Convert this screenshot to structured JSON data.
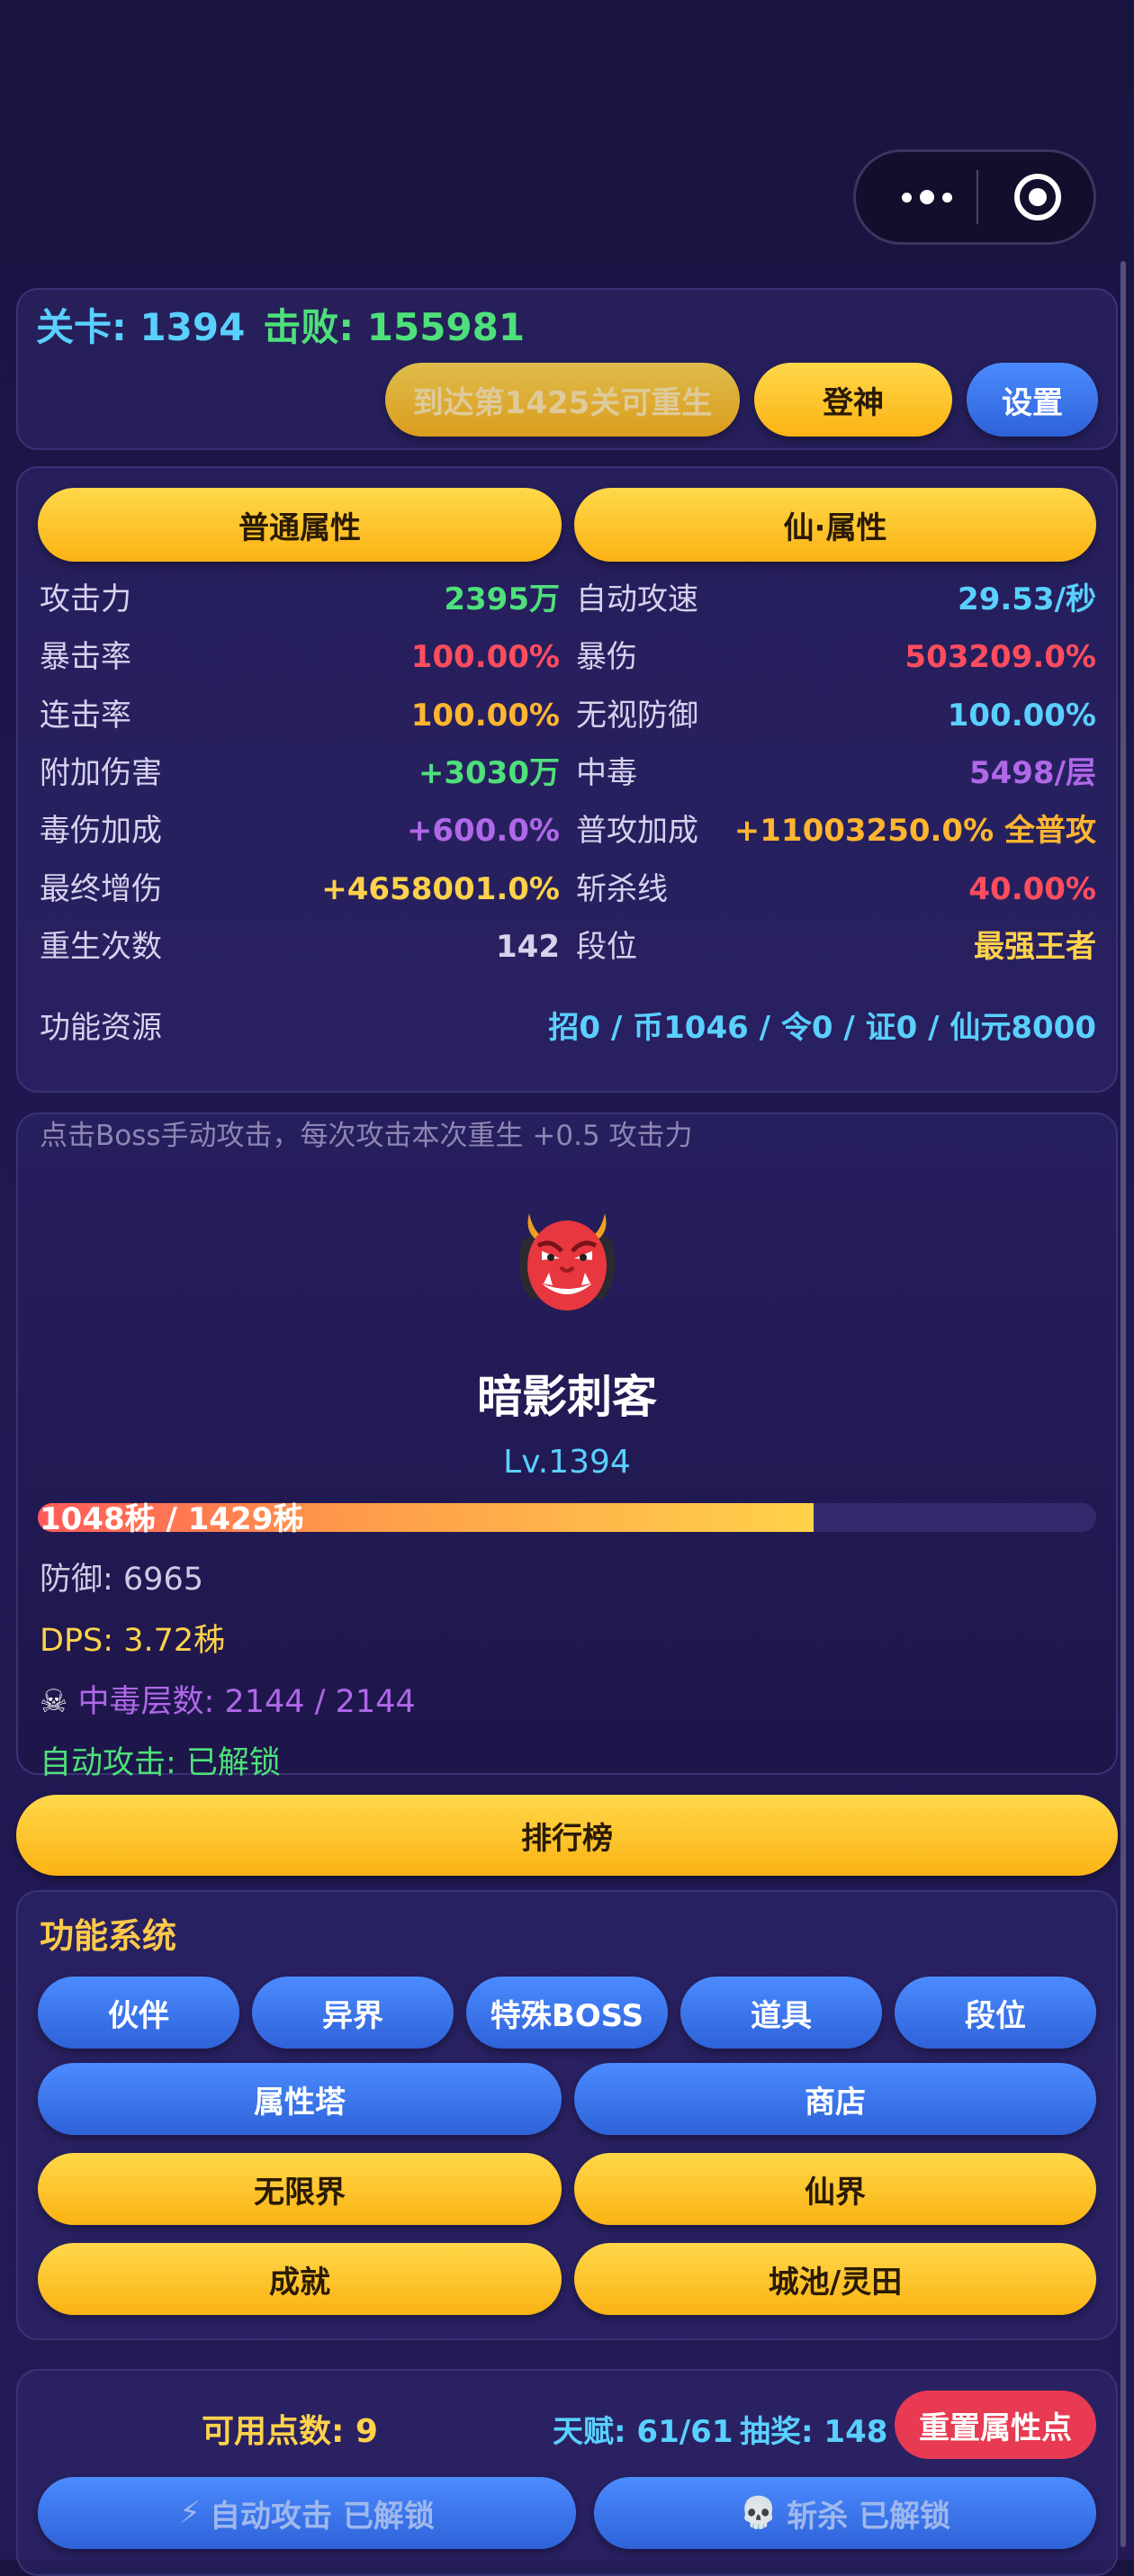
{
  "header": {
    "stage_label": "关卡: 1394",
    "kills_label": "击败: 155981",
    "rebirth_button": "到达第1425关可重生",
    "ascend_button": "登神",
    "settings_button": "设置"
  },
  "tabs": {
    "normal": "普通属性",
    "immortal": "仙·属性"
  },
  "attributes": {
    "left": [
      {
        "label": "攻击力",
        "value": "2395万",
        "color": "#4ee07a"
      },
      {
        "label": "暴击率",
        "value": "100.00%",
        "color": "#ff4d5e"
      },
      {
        "label": "连击率",
        "value": "100.00%",
        "color": "#ffb530"
      },
      {
        "label": "附加伤害",
        "value": "+3030万",
        "color": "#4ee07a"
      },
      {
        "label": "毒伤加成",
        "value": "+600.0%",
        "color": "#b067e8"
      },
      {
        "label": "最终增伤",
        "value": "+4658001.0%",
        "color": "#ffd24a"
      },
      {
        "label": "重生次数",
        "value": "142",
        "color": "#d6d2ee"
      }
    ],
    "right": [
      {
        "label": "自动攻速",
        "value": "29.53/秒",
        "color": "#5ad0ff"
      },
      {
        "label": "暴伤",
        "value": "503209.0%",
        "color": "#ff4d5e"
      },
      {
        "label": "无视防御",
        "value": "100.00%",
        "color": "#5ad0ff"
      },
      {
        "label": "中毒",
        "value": "5498/层",
        "color": "#b067e8"
      },
      {
        "label": "普攻加成",
        "value": "+11003250.0% 全普攻",
        "color": "#ffb530"
      },
      {
        "label": "斩杀线",
        "value": "40.00%",
        "color": "#ff4d5e"
      },
      {
        "label": "段位",
        "value": "最强王者",
        "color": "#ffd24a"
      }
    ],
    "resources_label": "功能资源",
    "resources_value": "招0 / 币1046 / 令0 / 证0 / 仙元8000"
  },
  "boss": {
    "hint": "点击Boss手动攻击，每次攻击本次重生 +0.5 攻击力",
    "icon": "ogre-mask-icon",
    "name": "暗影刺客",
    "level": "Lv.1394",
    "hp_text": "1048秭 / 1429秭",
    "hp_fraction": 0.733,
    "defense": "防御: 6965",
    "dps": "DPS: 3.72秭",
    "poison": "中毒层数: 2144 / 2144",
    "auto_attack": "自动攻击: 已解锁"
  },
  "leaderboard_button": "排行榜",
  "features": {
    "title": "功能系统",
    "row1": [
      "伙伴",
      "异界",
      "特殊BOSS",
      "道具",
      "段位"
    ],
    "row2": [
      "属性塔",
      "商店"
    ],
    "row3": [
      "无限界",
      "仙界"
    ],
    "row4": [
      "成就",
      "城池/灵田"
    ]
  },
  "footer": {
    "points": "可用点数: 9",
    "talent": "天赋: 61/61",
    "lottery": "抽奖: 148",
    "reset_button": "重置属性点",
    "auto_attack_button": "自动攻击 已解锁",
    "execute_button": "斩杀 已解锁"
  },
  "colors": {
    "gold": "#ffc94a",
    "blue": "#3a72ec",
    "green": "#4ee07a",
    "cyan": "#5ad0ff",
    "red": "#e83a52"
  }
}
